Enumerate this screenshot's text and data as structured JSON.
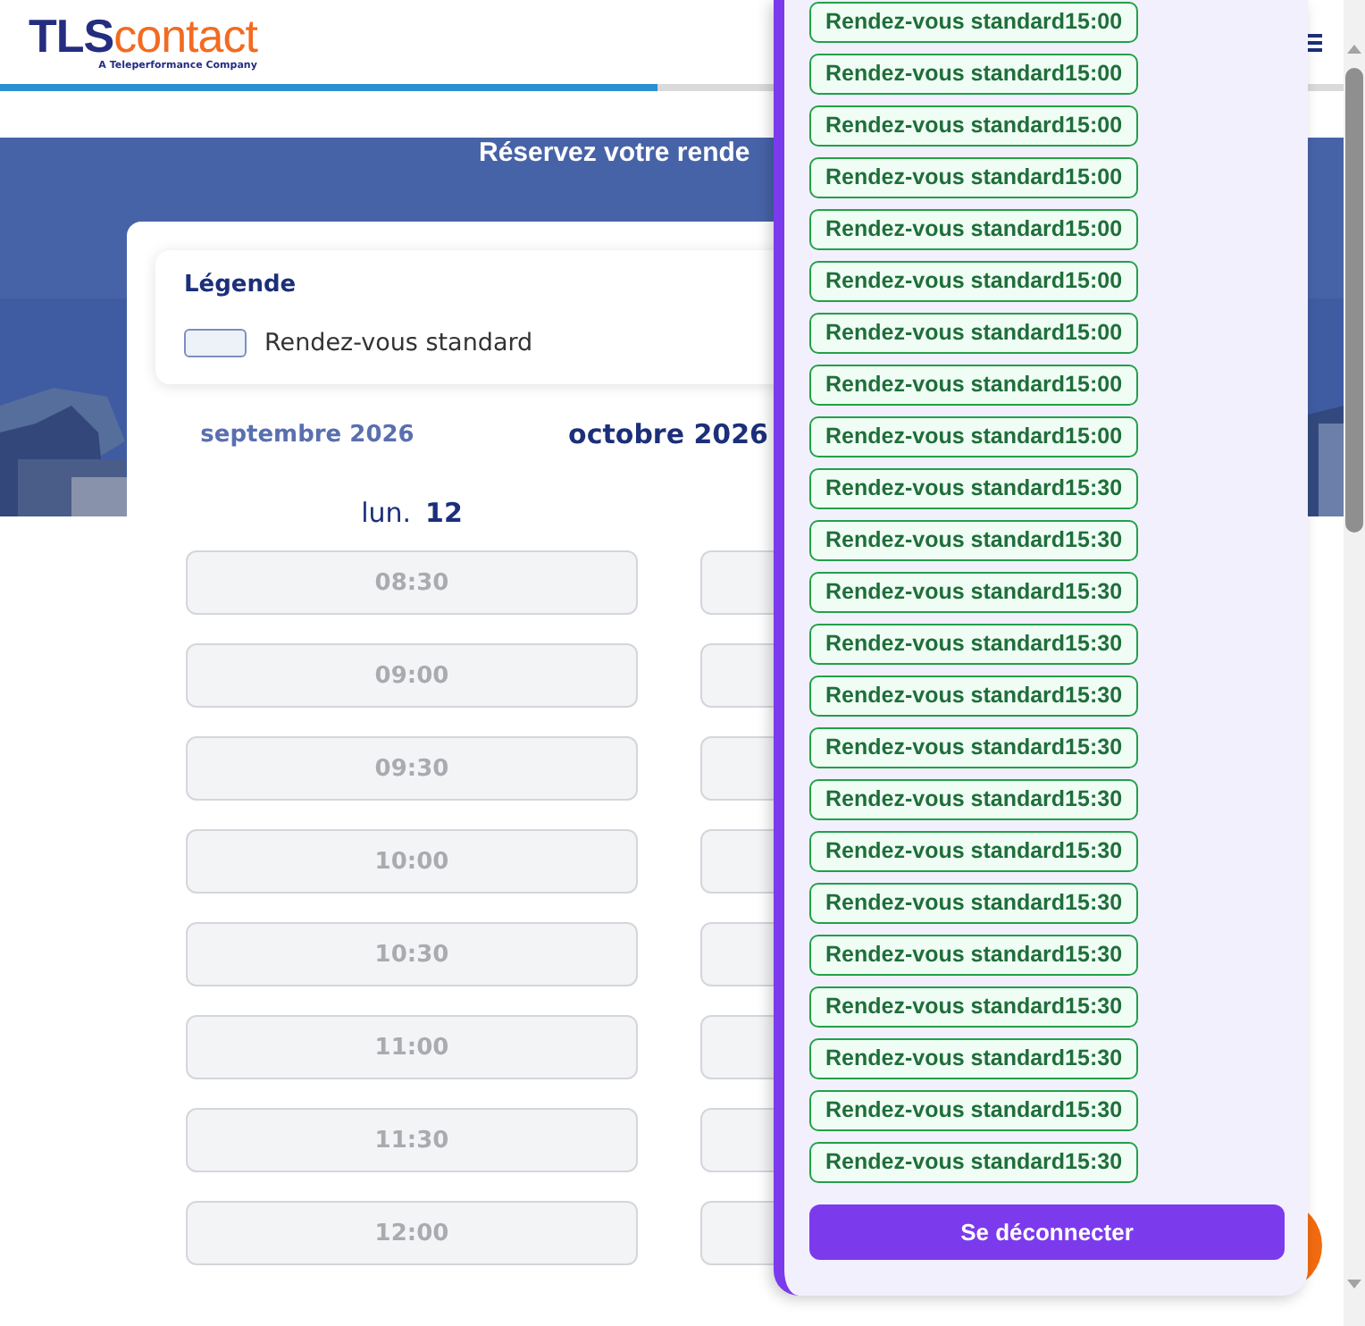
{
  "header": {
    "logo": {
      "brand": "TLS",
      "brand_suffix": "contact",
      "tagline": "A Teleperformance Company"
    },
    "progress": {
      "level": 0.49
    }
  },
  "hero": {
    "title": "Réservez votre rende"
  },
  "legend": {
    "title": "Légende",
    "items": [
      {
        "label": "Rendez-vous standard"
      }
    ]
  },
  "months": [
    {
      "label": "septembre 2026",
      "selected": false
    },
    {
      "label": "octobre 2026",
      "selected": true
    }
  ],
  "day": {
    "weekday": "lun.",
    "date": "12",
    "slots": [
      {
        "time": "08:30",
        "disabled": true
      },
      {
        "time": "09:00",
        "disabled": true
      },
      {
        "time": "09:30",
        "disabled": true
      },
      {
        "time": "10:00",
        "disabled": true
      },
      {
        "time": "10:30",
        "disabled": true
      },
      {
        "time": "11:00",
        "disabled": true
      },
      {
        "time": "11:30",
        "disabled": true
      },
      {
        "time": "12:00",
        "disabled": true
      }
    ]
  },
  "panel": {
    "slots": [
      {
        "label": "Rendez-vous standard",
        "time": "15:00"
      },
      {
        "label": "Rendez-vous standard",
        "time": "15:00"
      },
      {
        "label": "Rendez-vous standard",
        "time": "15:00"
      },
      {
        "label": "Rendez-vous standard",
        "time": "15:00"
      },
      {
        "label": "Rendez-vous standard",
        "time": "15:00"
      },
      {
        "label": "Rendez-vous standard",
        "time": "15:00"
      },
      {
        "label": "Rendez-vous standard",
        "time": "15:00"
      },
      {
        "label": "Rendez-vous standard",
        "time": "15:00"
      },
      {
        "label": "Rendez-vous standard",
        "time": "15:00"
      },
      {
        "label": "Rendez-vous standard",
        "time": "15:30"
      },
      {
        "label": "Rendez-vous standard",
        "time": "15:30"
      },
      {
        "label": "Rendez-vous standard",
        "time": "15:30"
      },
      {
        "label": "Rendez-vous standard",
        "time": "15:30"
      },
      {
        "label": "Rendez-vous standard",
        "time": "15:30"
      },
      {
        "label": "Rendez-vous standard",
        "time": "15:30"
      },
      {
        "label": "Rendez-vous standard",
        "time": "15:30"
      },
      {
        "label": "Rendez-vous standard",
        "time": "15:30"
      },
      {
        "label": "Rendez-vous standard",
        "time": "15:30"
      },
      {
        "label": "Rendez-vous standard",
        "time": "15:30"
      },
      {
        "label": "Rendez-vous standard",
        "time": "15:30"
      },
      {
        "label": "Rendez-vous standard",
        "time": "15:30"
      },
      {
        "label": "Rendez-vous standard",
        "time": "15:30"
      },
      {
        "label": "Rendez-vous standard",
        "time": "15:30"
      }
    ],
    "logout_button": "Se déconnecter"
  }
}
